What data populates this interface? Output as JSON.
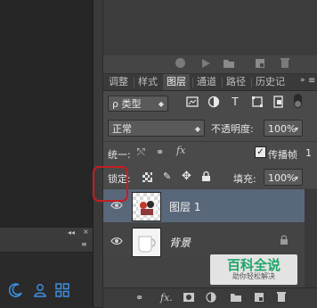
{
  "left_panel": {
    "collapse_arrows": "◂◂",
    "close_x": "×",
    "menu_glyph": "≡"
  },
  "tabs": [
    {
      "label": "调整",
      "active": false
    },
    {
      "label": "样式",
      "active": false
    },
    {
      "label": "图层",
      "active": true
    },
    {
      "label": "通道",
      "active": false
    },
    {
      "label": "路径",
      "active": false
    },
    {
      "label": "历史记",
      "active": false
    }
  ],
  "filter": {
    "kind_label": "类型",
    "kind_prefix": "ρ"
  },
  "blend": {
    "mode": "正常",
    "opacity_label": "不透明度:",
    "opacity_value": "100%"
  },
  "unify": {
    "label": "统一:",
    "propagate_label": "传播帧",
    "propagate_checked": true,
    "propagate_count": "1"
  },
  "lock": {
    "label": "锁定:",
    "fill_label": "填充:",
    "fill_value": "100%"
  },
  "layers": [
    {
      "name": "图层 1",
      "visible": true,
      "selected": true
    },
    {
      "name": "背景",
      "visible": true,
      "selected": false,
      "locked": true
    }
  ],
  "watermark": {
    "title": "百科全说",
    "subtitle": "助你轻松解决"
  },
  "colors": {
    "selected_layer": "#59677a",
    "highlight_box": "#c41e23",
    "watermark_green": "#1fa66a"
  }
}
